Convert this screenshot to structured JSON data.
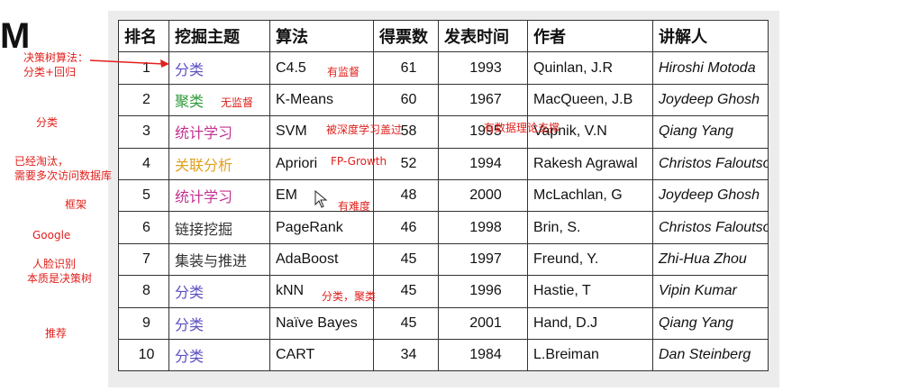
{
  "slide": {
    "left_glyph": "M"
  },
  "table": {
    "headers": {
      "rank": "排名",
      "topic": "挖掘主题",
      "algorithm": "算法",
      "votes": "得票数",
      "year": "发表时间",
      "author": "作者",
      "speaker": "讲解人"
    },
    "rows": [
      {
        "rank": "1",
        "topic": "分类",
        "topic_color": "#5b4fc0",
        "algorithm": "C4.5",
        "votes": "61",
        "year": "1993",
        "author": "Quinlan, J.R",
        "speaker": "Hiroshi Motoda"
      },
      {
        "rank": "2",
        "topic": "聚类",
        "topic_color": "#2f9a3a",
        "algorithm": "K-Means",
        "votes": "60",
        "year": "1967",
        "author": "MacQueen, J.B",
        "speaker": "Joydeep Ghosh"
      },
      {
        "rank": "3",
        "topic": "统计学习",
        "topic_color": "#c2338f",
        "algorithm": "SVM",
        "votes": "58",
        "year": "1995",
        "author": "Vapnik, V.N",
        "speaker": "Qiang Yang"
      },
      {
        "rank": "4",
        "topic": "关联分析",
        "topic_color": "#e0a020",
        "algorithm": "Apriori",
        "votes": "52",
        "year": "1994",
        "author": "Rakesh Agrawal",
        "speaker": "Christos Faloutsos"
      },
      {
        "rank": "5",
        "topic": "统计学习",
        "topic_color": "#c2338f",
        "algorithm": "EM",
        "votes": "48",
        "year": "2000",
        "author": "McLachlan, G",
        "speaker": "Joydeep Ghosh"
      },
      {
        "rank": "6",
        "topic": "链接挖掘",
        "topic_color": "#333333",
        "algorithm": "PageRank",
        "votes": "46",
        "year": "1998",
        "author": "Brin, S.",
        "speaker": "Christos Faloutsos"
      },
      {
        "rank": "7",
        "topic": "集装与推进",
        "topic_color": "#333333",
        "algorithm": "AdaBoost",
        "votes": "45",
        "year": "1997",
        "author": "Freund, Y.",
        "speaker": "Zhi-Hua Zhou"
      },
      {
        "rank": "8",
        "topic": "分类",
        "topic_color": "#5b4fc0",
        "algorithm": "kNN",
        "votes": "45",
        "year": "1996",
        "author": "Hastie, T",
        "speaker": "Vipin Kumar"
      },
      {
        "rank": "9",
        "topic": "分类",
        "topic_color": "#5b4fc0",
        "algorithm": "Naïve Bayes",
        "votes": "45",
        "year": "2001",
        "author": "Hand, D.J",
        "speaker": "Qiang Yang"
      },
      {
        "rank": "10",
        "topic": "分类",
        "topic_color": "#5b4fc0",
        "algorithm": "CART",
        "votes": "34",
        "year": "1984",
        "author": "L.Breiman",
        "speaker": "Dan Steinberg"
      }
    ]
  },
  "annotations": {
    "color": "#e0201c",
    "decision_tree_1": "决策树算法：",
    "decision_tree_2": "分类+回归",
    "classify": "分类",
    "obsolete_1": "已经淘汰，",
    "obsolete_2": "需要多次访问数据库",
    "framework": "框架",
    "google": "Google",
    "face_1": "人脸识别",
    "face_2": "本质是决策树",
    "recommend": "推荐",
    "supervised": "有监督",
    "unsupervised": "无监督",
    "deep_learning": "被深度学习盖过",
    "data_theory": "有数据理论支撑",
    "fp_growth": "FP-Growth",
    "difficult": "有难度",
    "classify_cluster": "分类，聚类"
  },
  "cursor_icon": "mouse-pointer-icon",
  "arrow_icon": "red-arrow-icon"
}
